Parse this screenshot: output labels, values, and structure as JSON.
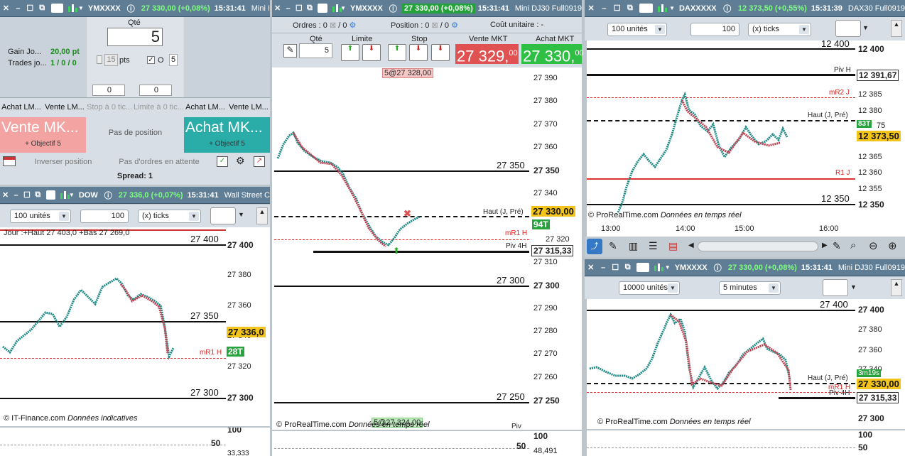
{
  "window_a": {
    "symbol": "YMXXXX",
    "price": "27 330,00 (+0,08%)",
    "time": "15:31:41",
    "title": "Mini I",
    "qty_label": "Qté",
    "qty_value": "5",
    "gain_label": "Gain Jo...",
    "gain_value": "20,00 pt",
    "trades_label": "Trades jo...",
    "trades_value": "1 / 0 / 0",
    "pts_value": "15",
    "pts_label": "pts",
    "oco_label": "O",
    "oco_value": "5",
    "stop_ticks": "0",
    "limit_ticks": "0",
    "tabs": [
      "Achat LM...",
      "Vente LM...",
      "Stop à 0 tic...",
      "Limite à 0 tic...",
      "Achat LM...",
      "Vente LM..."
    ],
    "sell_label": "Vente MK...",
    "buy_label": "Achat MK...",
    "sell_obj": "+ Objectif 5",
    "buy_obj": "+ Objectif 5",
    "no_position": "Pas de position",
    "reverse": "Inverser position",
    "no_orders": "Pas d'ordres en attente",
    "spread": "Spread:  1"
  },
  "window_b": {
    "symbol": "DOW",
    "price": "27 336,0 (+0,07%)",
    "time": "15:31:41",
    "title": "Wall Street C",
    "units": "100 unités",
    "ticks_value": "100",
    "ticks_label": "(x) ticks",
    "info": "Jour :+Haut 27 403,0 +Bas 27 269,0",
    "axis": [
      "27 400",
      "27 380",
      "27 360",
      "27 340",
      "27 320",
      "27 300"
    ],
    "lvl_27400": "27 400",
    "lvl_27350": "27 350",
    "lvl_27300": "27 300",
    "price_box": "27 336,0",
    "vol_tag": "28T",
    "r1": "mR1 H",
    "source": "© IT-Finance.com",
    "source_note": "Données indicatives",
    "osc": [
      "100",
      "50",
      "33,333"
    ]
  },
  "window_c": {
    "symbol": "YMXXXX",
    "price": "27 330,00 (+0,08%)",
    "time": "15:31:41",
    "title": "Mini DJ30 Full0919",
    "orders": "Ordres : 0",
    "orders_b": "/ 0",
    "position": "Position : 0",
    "position_b": "/ 0",
    "unit_cost": "Coût unitaire : -",
    "h_qty": "Qté",
    "h_limit": "Limite",
    "h_stop": "Stop",
    "h_sell": "Vente MKT",
    "h_buy": "Achat MKT",
    "qty": "5",
    "sell_price": "27 329,",
    "sell_dec": "00",
    "buy_price": "27 330,",
    "buy_dec": "00",
    "order_tag": "5@27 328,00",
    "order_tag2": "5@27 324,00",
    "axis": [
      "27 390",
      "27 380",
      "27 370",
      "27 360",
      "27 340",
      "27 320",
      "27 310",
      "27 290",
      "27 280",
      "27 270",
      "27 260"
    ],
    "ax_b": [
      "27 350",
      "27 330,00",
      "27 315,33",
      "27 300",
      "27 250"
    ],
    "lvl_27350": "27 350",
    "lvl_27300": "27 300",
    "lvl_27250": "27 250",
    "haut": "Haut (J, Pré)",
    "r1": "mR1 H",
    "piv": "Piv 4H",
    "vol_tag": "94T",
    "source": "© ProRealTime.com",
    "source_note": "Données en temps réel",
    "piv2": "Piv",
    "osc": [
      "100",
      "50",
      "48,491"
    ]
  },
  "window_d": {
    "symbol": "DAXXXXX",
    "price": "12 373,50 (+0,55%)",
    "time": "15:31:39",
    "title": "DAX30 Full0919",
    "units": "100 unités",
    "ticks_value": "100",
    "ticks_label": "(x) ticks",
    "axis": [
      "12 400",
      "12 391,67",
      "12 385",
      "12 380",
      "12 373,50",
      "12 365",
      "12 360",
      "12 355",
      "12 350"
    ],
    "ax75": "75",
    "vol_tag": "83T",
    "lvl_12400": "12 400",
    "lvl_12350": "12 350",
    "piv": "Piv H",
    "r2": "mR2 J",
    "haut": "Haut (J, Pré)",
    "r1": "R1 J",
    "source": "© ProRealTime.com",
    "source_note": "Données en temps réel",
    "times": [
      "13:00",
      "14:00",
      "15:00",
      "16:00"
    ]
  },
  "window_e": {
    "symbol": "YMXXXX",
    "price": "27 330,00 (+0,08%)",
    "time": "15:31:41",
    "title": "Mini DJ30 Full0919",
    "units": "10000 unités",
    "interval": "5 minutes",
    "axis": [
      "27 400",
      "27 380",
      "27 360",
      "27 340"
    ],
    "ax_b": [
      "27 330,00",
      "27 315,33",
      "27 300"
    ],
    "lvl_27400": "27 400",
    "haut": "Haut (J, Pré)",
    "r1": "mR1 H",
    "piv": "Piv 4H",
    "timer": "3m19s",
    "source": "© ProRealTime.com",
    "source_note": "Données en temps réel",
    "osc": [
      "100",
      "50"
    ]
  },
  "colors": {
    "titlebar": "#5f7e96",
    "up": "#1d8a86",
    "down": "#c0404f",
    "sell_red": "#e05252",
    "buy_green": "#2fbf45",
    "price_yellow": "#f3c51c"
  }
}
